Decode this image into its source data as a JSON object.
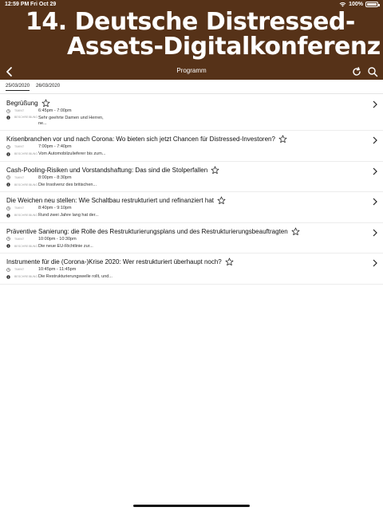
{
  "status_bar": {
    "time": "12:59 PM",
    "date": "Fri Oct 29",
    "battery": "100%"
  },
  "header": {
    "title_line1": "14. Deutsche Distressed-",
    "title_line2": "Assets-Digitalkonferenz"
  },
  "nav": {
    "title": "Programm"
  },
  "tabs": [
    {
      "label": "25/03/2020"
    },
    {
      "label": "26/03/2020"
    }
  ],
  "labels": {
    "time": "TIMINT",
    "description": "BESCHREIBUNG"
  },
  "sessions": [
    {
      "title": "Begrüßung",
      "time": "6:45pm - 7:00pm",
      "desc": "Sehr geehrte Damen und Herren, ne..."
    },
    {
      "title": "Krisenbranchen vor und nach Corona: Wo bieten sich jetzt Chancen für Distressed-Investoren?",
      "time": "7:00pm - 7:40pm",
      "desc": "Vom Automobilzulieferer bis zum..."
    },
    {
      "title": "Cash-Pooling-Risiken und Vorstandshaftung: Das sind die Stolperfallen",
      "time": "8:00pm - 8:30pm",
      "desc": "Die Insolvenz des britischen..."
    },
    {
      "title": "Die Weichen neu stellen: Wie Schaltbau restrukturiert und refinanziert hat",
      "time": "8:40pm - 9:10pm",
      "desc": "Rund zwei Jahre lang hat der..."
    },
    {
      "title": "Präventive Sanierung: die Rolle des Restrukturierungsplans und des Restrukturierungsbeauftragten",
      "time": "10:00pm - 10:30pm",
      "desc": "Die neue EU-Richtlinie zur..."
    },
    {
      "title": "Instrumente für die (Corona-)Krise 2020: Wer restrukturiert überhaupt noch?",
      "time": "10:45pm - 11:45pm",
      "desc": "Die Restrukturierungswelle rollt, und..."
    }
  ]
}
